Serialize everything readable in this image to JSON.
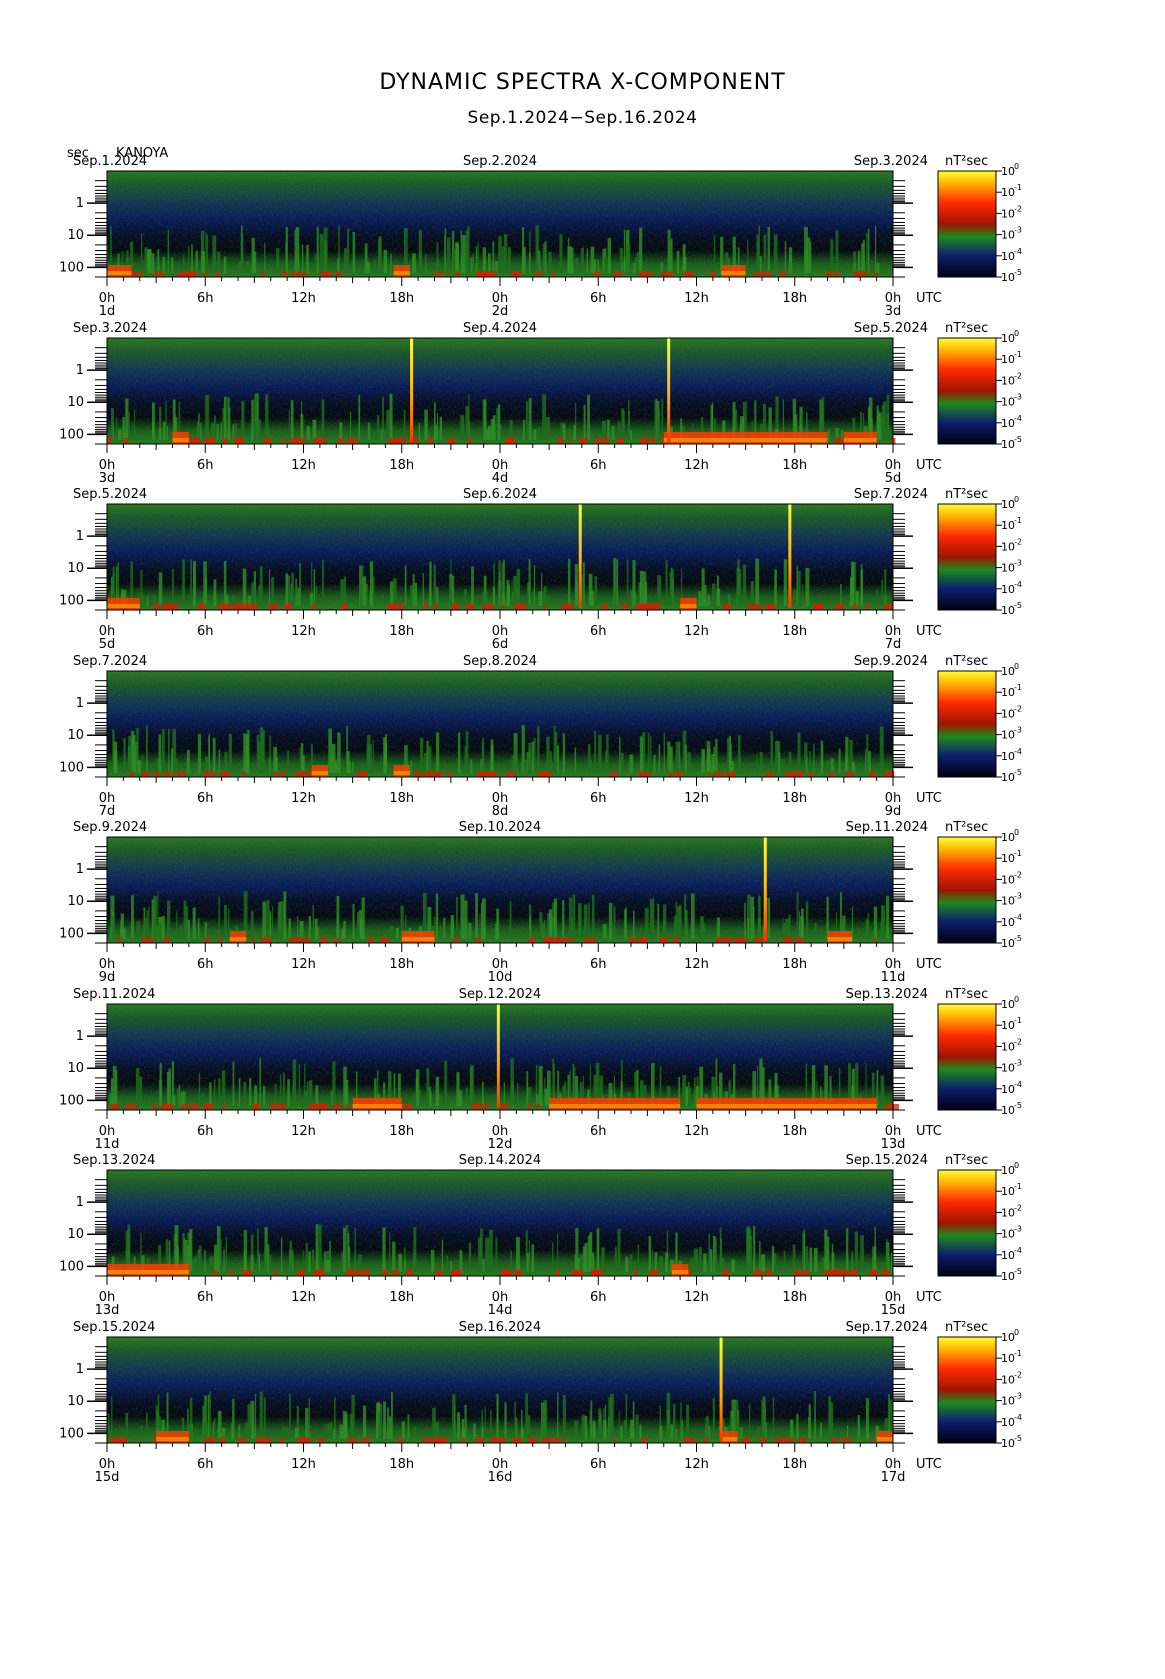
{
  "header": {
    "title": "DYNAMIC SPECTRA X-COMPONENT",
    "subtitle": "Sep.1.2024−Sep.16.2024",
    "y_unit": "sec",
    "station": "KANOYA"
  },
  "chart_data": {
    "type": "heatmap",
    "y_axis": {
      "label": "sec",
      "ticks": [
        "1",
        "10",
        "100"
      ],
      "scale": "log"
    },
    "x_tick_labels": [
      "0h",
      "6h",
      "12h",
      "18h",
      "0h",
      "6h",
      "12h",
      "18h",
      "0h"
    ],
    "x_unit": "UTC",
    "colorbar": {
      "unit": "nT²sec",
      "exponents": [
        "0",
        "-1",
        "-2",
        "-3",
        "-4",
        "-5"
      ],
      "base": "10",
      "colors": [
        "#ffff30",
        "#ff2a00",
        "#1e8a1e",
        "#0c1f6e",
        "#000010"
      ]
    },
    "panels": [
      {
        "left_date": "Sep.1.2024",
        "mid_date": "Sep.2.2024",
        "right_date": "Sep.3.2024",
        "day_labels": [
          "1d",
          "2d",
          "3d"
        ],
        "spikes": [],
        "active_hours": [
          [
            0,
            1.5
          ],
          [
            17.5,
            18.5
          ],
          [
            37.5,
            39
          ]
        ]
      },
      {
        "left_date": "Sep.3.2024",
        "mid_date": "Sep.4.2024",
        "right_date": "Sep.5.2024",
        "day_labels": [
          "3d",
          "4d",
          "5d"
        ],
        "spikes": [
          18.6,
          34.3
        ],
        "active_hours": [
          [
            4,
            5
          ],
          [
            34,
            44
          ],
          [
            45,
            47
          ]
        ]
      },
      {
        "left_date": "Sep.5.2024",
        "mid_date": "Sep.6.2024",
        "right_date": "Sep.7.2024",
        "day_labels": [
          "5d",
          "6d",
          "7d"
        ],
        "spikes": [
          28.9,
          41.7
        ],
        "active_hours": [
          [
            0,
            2
          ],
          [
            35,
            36
          ]
        ]
      },
      {
        "left_date": "Sep.7.2024",
        "mid_date": "Sep.8.2024",
        "right_date": "Sep.9.2024",
        "day_labels": [
          "7d",
          "8d",
          "9d"
        ],
        "spikes": [],
        "active_hours": [
          [
            12.5,
            13.5
          ],
          [
            17.5,
            18.5
          ]
        ]
      },
      {
        "left_date": "Sep.9.2024",
        "mid_date": "Sep.10.2024",
        "right_date": "Sep.11.2024",
        "day_labels": [
          "9d",
          "10d",
          "11d"
        ],
        "spikes": [
          40.2
        ],
        "active_hours": [
          [
            7.5,
            8.5
          ],
          [
            18,
            20
          ],
          [
            44,
            45.5
          ]
        ]
      },
      {
        "left_date": "Sep.11.2024",
        "mid_date": "Sep.12.2024",
        "right_date": "Sep.13.2024",
        "day_labels": [
          "11d",
          "12d",
          "13d"
        ],
        "spikes": [
          23.9
        ],
        "active_hours": [
          [
            15,
            18
          ],
          [
            27,
            35
          ],
          [
            36,
            47
          ]
        ]
      },
      {
        "left_date": "Sep.13.2024",
        "mid_date": "Sep.14.2024",
        "right_date": "Sep.15.2024",
        "day_labels": [
          "13d",
          "14d",
          "15d"
        ],
        "spikes": [],
        "active_hours": [
          [
            0,
            5
          ],
          [
            34.5,
            35.5
          ]
        ]
      },
      {
        "left_date": "Sep.15.2024",
        "mid_date": "Sep.16.2024",
        "right_date": "Sep.17.2024",
        "day_labels": [
          "15d",
          "16d",
          "17d"
        ],
        "spikes": [
          37.5
        ],
        "active_hours": [
          [
            3,
            5
          ],
          [
            37.5,
            38.5
          ],
          [
            47,
            48
          ]
        ]
      }
    ]
  }
}
